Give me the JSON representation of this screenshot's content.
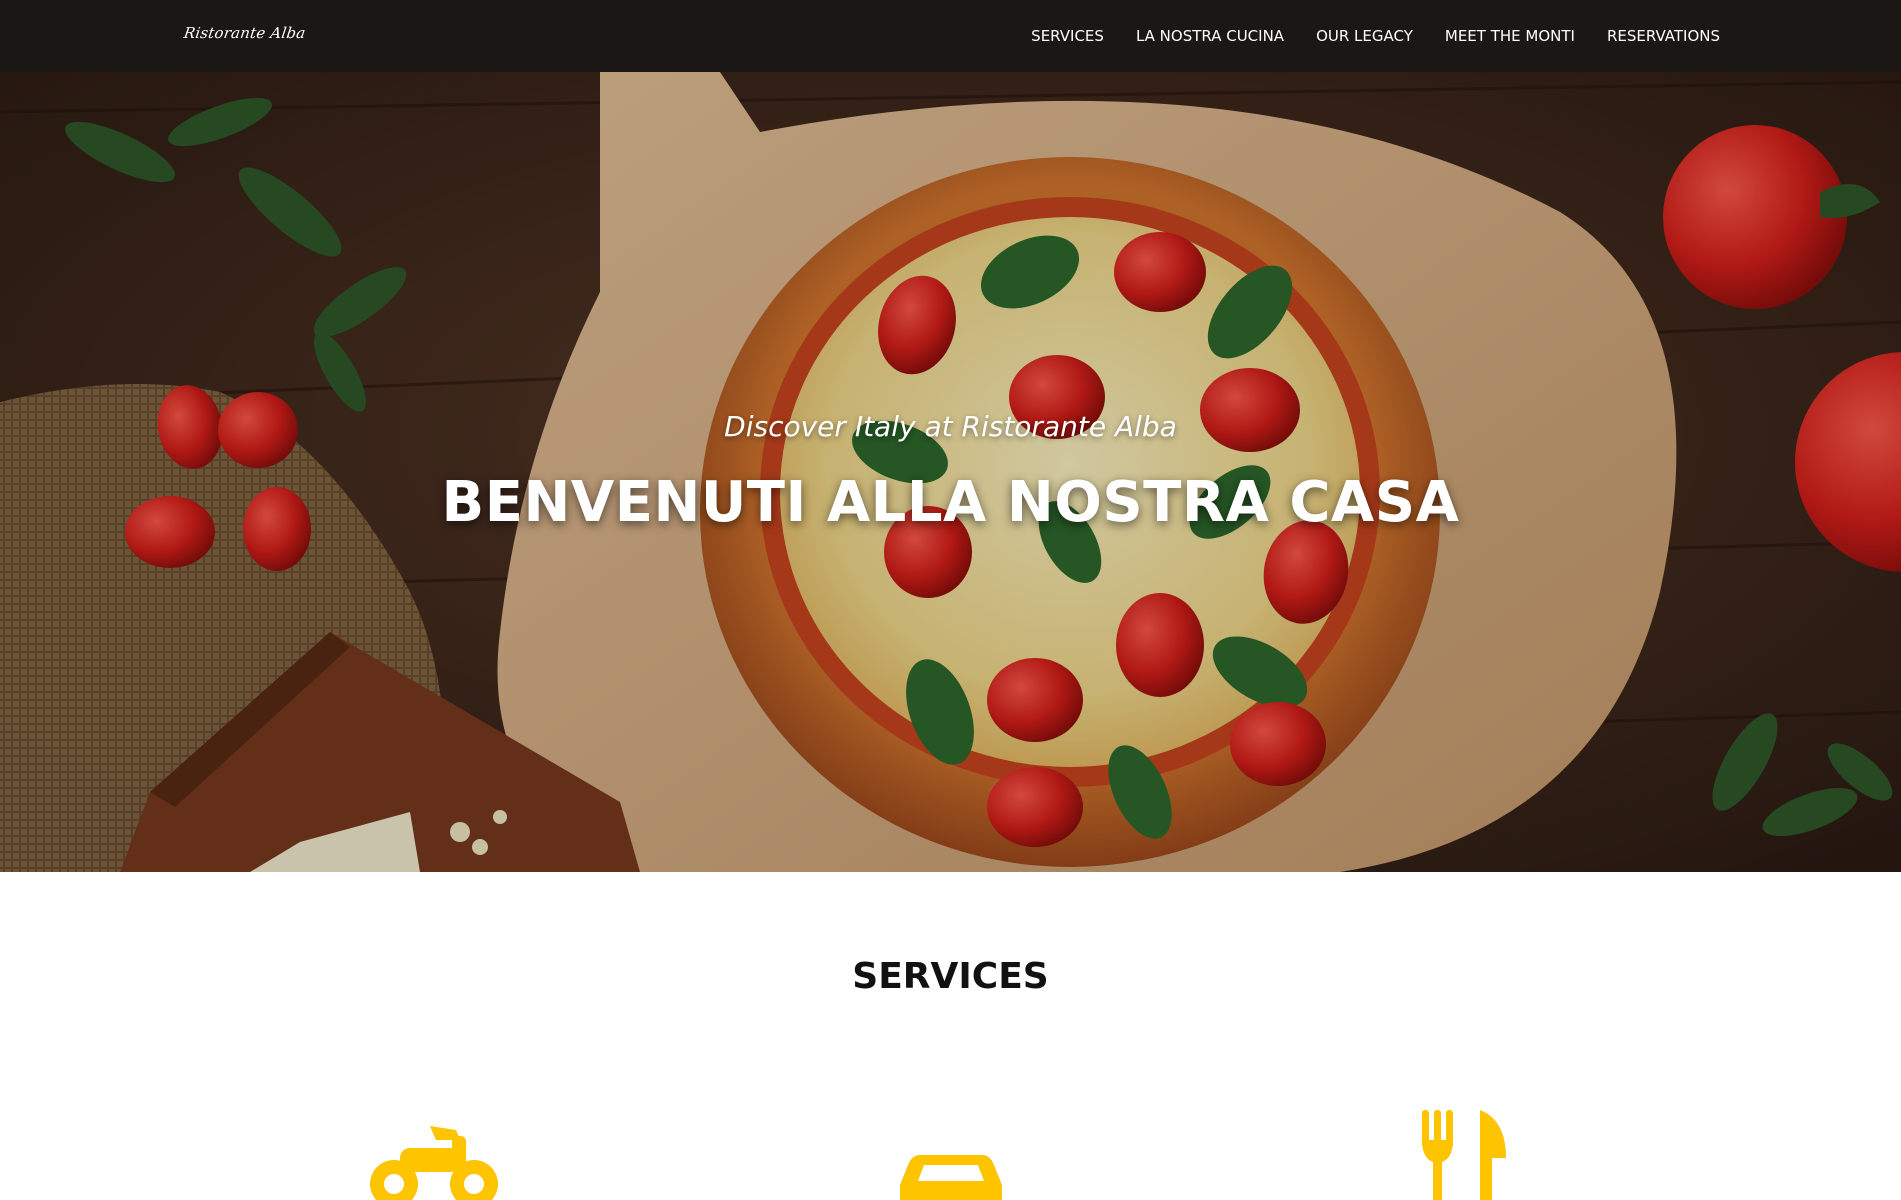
{
  "brand": {
    "name": "Ristorante Alba"
  },
  "nav": {
    "items": [
      {
        "label": "SERVICES"
      },
      {
        "label": "LA NOSTRA CUCINA"
      },
      {
        "label": "OUR LEGACY"
      },
      {
        "label": "MEET THE MONTI"
      },
      {
        "label": "RESERVATIONS"
      }
    ]
  },
  "hero": {
    "subtitle": "Discover Italy at Ristorante Alba",
    "title": "BENVENUTI ALLA NOSTRA CASA"
  },
  "services": {
    "title": "SERVICES",
    "icons": [
      "motorcycle-icon",
      "car-icon",
      "utensils-icon"
    ]
  },
  "colors": {
    "navbar": "#1b1714",
    "accent": "#ffc400",
    "text_dark": "#111111"
  }
}
